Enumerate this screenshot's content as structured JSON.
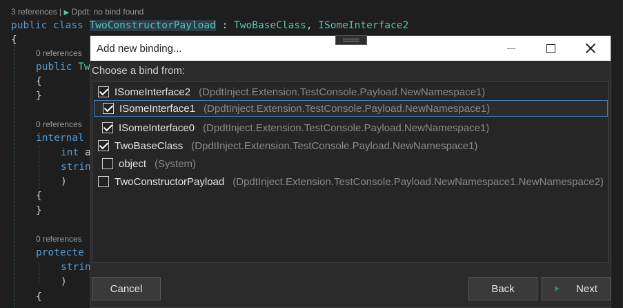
{
  "editor": {
    "lens_top_refs": "3 references",
    "lens_top_sep": "|",
    "lens_top_dpdt": "Dpdt: no bind found",
    "class_line": {
      "kw1": "public",
      "kw2": "class",
      "name": "TwoConstructorPayload",
      "colon": ":",
      "base": "TwoBaseClass",
      "comma": ",",
      "iface": "ISomeInterface2"
    },
    "brace_open": "{",
    "lens_refs": "0 references",
    "lines": {
      "ctor1_kw": "public",
      "ctor1_rest": "Tw",
      "internal_kw": "internal",
      "int_kw": "int",
      "int_rest": "a",
      "string_kw": "strin",
      "close_paren": ")",
      "protected_kw": "protecte",
      "string2_kw": "strin",
      "close_paren2": ")",
      "brace_close": "}"
    }
  },
  "dialog": {
    "title": "Add new binding...",
    "prompt": "Choose a bind from:",
    "items": [
      {
        "name": "ISomeInterface2",
        "ns": "(DpdtInject.Extension.TestConsole.Payload.NewNamespace1)",
        "checked": true
      },
      {
        "name": "ISomeInterface1",
        "ns": "(DpdtInject.Extension.TestConsole.Payload.NewNamespace1)",
        "checked": true
      },
      {
        "name": "ISomeInterface0",
        "ns": "(DpdtInject.Extension.TestConsole.Payload.NewNamespace1)",
        "checked": true
      },
      {
        "name": "TwoBaseClass",
        "ns": "(DpdtInject.Extension.TestConsole.Payload.NewNamespace1)",
        "checked": true
      },
      {
        "name": "object",
        "ns": "(System)",
        "checked": false
      },
      {
        "name": "TwoConstructorPayload",
        "ns": "(DpdtInject.Extension.TestConsole.Payload.NewNamespace1.NewNamespace2)",
        "checked": false
      }
    ],
    "buttons": {
      "cancel": "Cancel",
      "back": "Back",
      "next": "Next"
    }
  }
}
